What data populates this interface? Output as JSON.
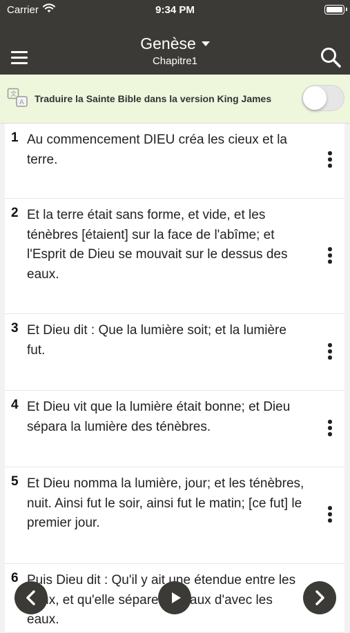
{
  "status_bar": {
    "carrier": "Carrier",
    "time": "9:34 PM"
  },
  "header": {
    "book": "Genèse",
    "chapter": "Chapitre1"
  },
  "translate": {
    "label": "Traduire la Sainte Bible dans la version King James",
    "enabled": false
  },
  "verses": [
    {
      "num": "1",
      "text": "Au commencement DIEU créa les cieux et la terre."
    },
    {
      "num": "2",
      "text": "Et la terre était sans forme, et vide, et les ténèbres [étaient] sur la face de l'abîme; et l'Esprit de Dieu se mouvait sur le dessus des eaux."
    },
    {
      "num": "3",
      "text": "Et Dieu dit : Que la lumière soit; et la lumière fut."
    },
    {
      "num": "4",
      "text": "Et Dieu vit que la lumière était bonne; et Dieu sépara la lumière des ténèbres."
    },
    {
      "num": "5",
      "text": "Et Dieu nomma la lumière, jour; et les ténèbres, nuit. Ainsi fut le soir, ainsi fut le matin; [ce fut] le premier jour."
    },
    {
      "num": "6",
      "text": "Puis Dieu dit : Qu'il y ait une étendue entre les eaux, et qu'elle sépare les eaux d'avec les eaux."
    }
  ],
  "icons": {
    "menu": "hamburger-menu-icon",
    "search": "search-icon",
    "translate": "translate-icon",
    "more": "vertical-dots-icon",
    "previous": "chevron-left-icon",
    "play": "play-icon",
    "next": "chevron-right-icon"
  },
  "colors": {
    "header_bg": "#3c3a36",
    "translate_bar_bg": "#eef6dc",
    "page_bg": "#f2f2f2"
  }
}
